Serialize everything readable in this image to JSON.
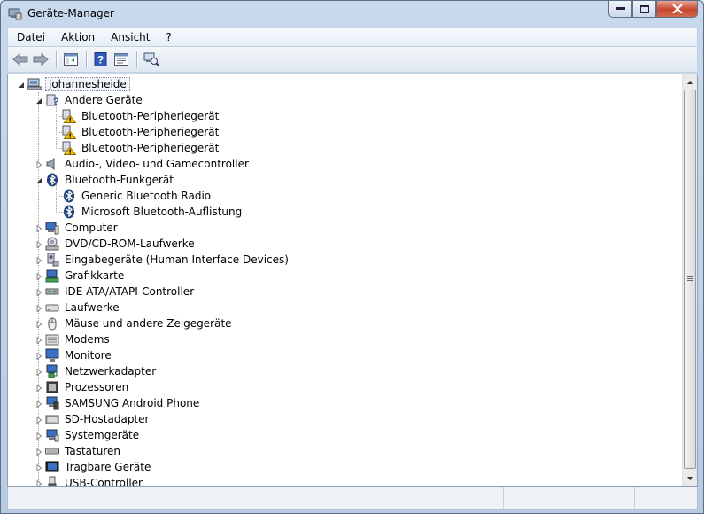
{
  "window": {
    "title": "Geräte-Manager"
  },
  "menu": {
    "items": [
      "Datei",
      "Aktion",
      "Ansicht",
      "?"
    ]
  },
  "toolbar": {
    "buttons": [
      "back-icon",
      "forward-icon",
      "console-tree-icon",
      "help-icon",
      "properties-icon",
      "scan-hardware-icon"
    ]
  },
  "tree": {
    "root": "johannesheide",
    "nodes": [
      {
        "label": "Andere Geräte",
        "icon": "unknown-device-icon",
        "expanded": true,
        "children": [
          {
            "label": "Bluetooth-Peripheriegerät",
            "icon": "warning-device-icon"
          },
          {
            "label": "Bluetooth-Peripheriegerät",
            "icon": "warning-device-icon"
          },
          {
            "label": "Bluetooth-Peripheriegerät",
            "icon": "warning-device-icon"
          }
        ]
      },
      {
        "label": "Audio-, Video- und Gamecontroller",
        "icon": "speaker-icon",
        "expanded": false
      },
      {
        "label": "Bluetooth-Funkgerät",
        "icon": "bluetooth-icon",
        "expanded": true,
        "children": [
          {
            "label": "Generic Bluetooth Radio",
            "icon": "bluetooth-icon"
          },
          {
            "label": "Microsoft Bluetooth-Auflistung",
            "icon": "bluetooth-icon"
          }
        ]
      },
      {
        "label": "Computer",
        "icon": "computer-icon",
        "expanded": false
      },
      {
        "label": "DVD/CD-ROM-Laufwerke",
        "icon": "dvd-drive-icon",
        "expanded": false
      },
      {
        "label": "Eingabegeräte (Human Interface Devices)",
        "icon": "hid-icon",
        "expanded": false
      },
      {
        "label": "Grafikkarte",
        "icon": "display-adapter-icon",
        "expanded": false
      },
      {
        "label": "IDE ATA/ATAPI-Controller",
        "icon": "ide-controller-icon",
        "expanded": false
      },
      {
        "label": "Laufwerke",
        "icon": "disk-drive-icon",
        "expanded": false
      },
      {
        "label": "Mäuse und andere Zeigegeräte",
        "icon": "mouse-icon",
        "expanded": false
      },
      {
        "label": "Modems",
        "icon": "modem-icon",
        "expanded": false
      },
      {
        "label": "Monitore",
        "icon": "monitor-icon",
        "expanded": false
      },
      {
        "label": "Netzwerkadapter",
        "icon": "network-adapter-icon",
        "expanded": false
      },
      {
        "label": "Prozessoren",
        "icon": "processor-icon",
        "expanded": false
      },
      {
        "label": "SAMSUNG Android Phone",
        "icon": "phone-icon",
        "expanded": false
      },
      {
        "label": "SD-Hostadapter",
        "icon": "sd-host-icon",
        "expanded": false
      },
      {
        "label": "Systemgeräte",
        "icon": "system-device-icon",
        "expanded": false
      },
      {
        "label": "Tastaturen",
        "icon": "keyboard-icon",
        "expanded": false
      },
      {
        "label": "Tragbare Geräte",
        "icon": "portable-device-icon",
        "expanded": false
      },
      {
        "label": "USB-Controller",
        "icon": "usb-icon",
        "expanded": false
      }
    ]
  },
  "colors": {
    "accent": "#1f3f78",
    "warning": "#f5c400",
    "selection_border": "#7a8ba3"
  }
}
